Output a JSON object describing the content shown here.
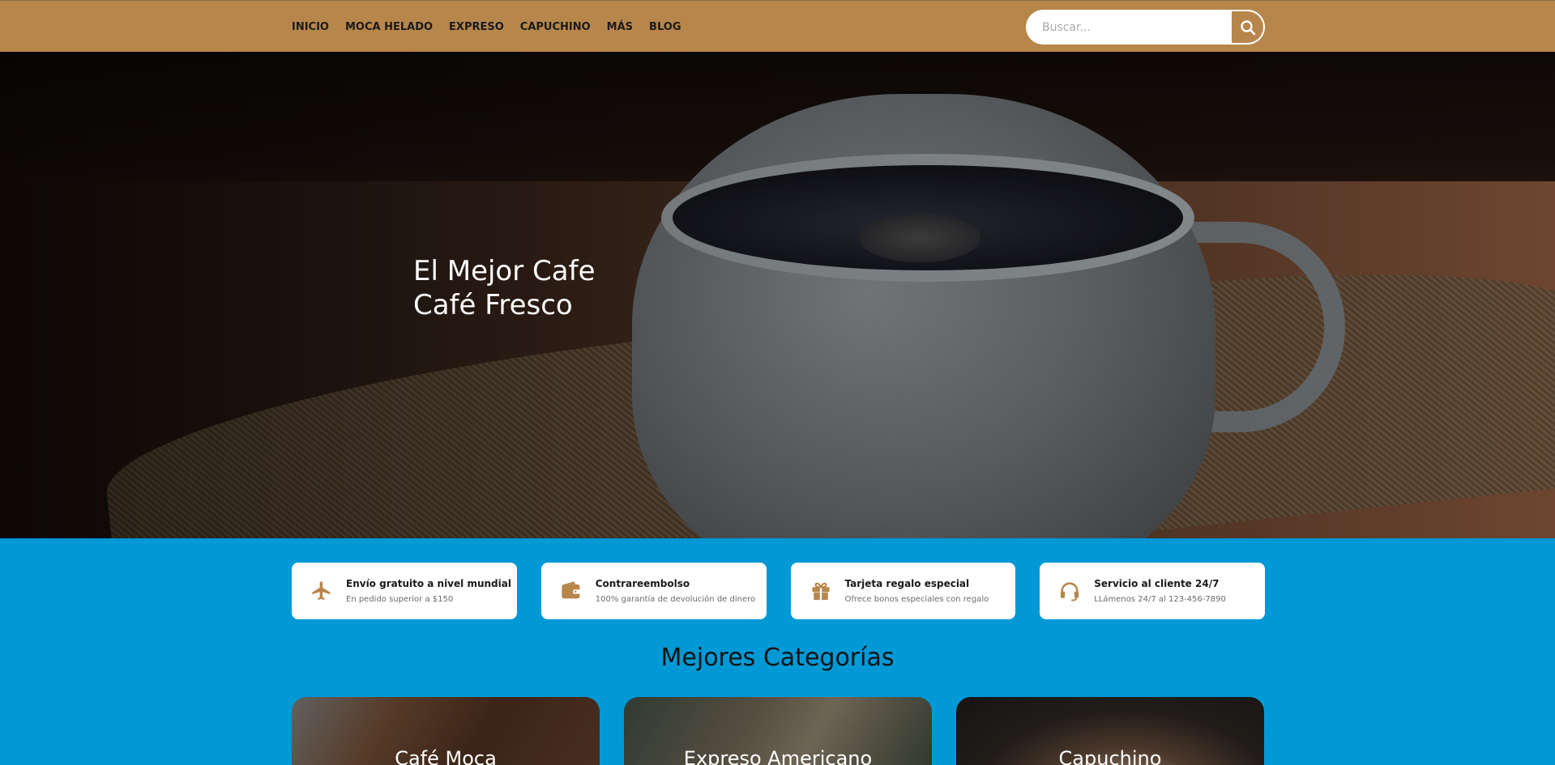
{
  "header": {
    "nav": [
      "INICIO",
      "MOCA HELADO",
      "EXPRESO",
      "CAPUCHINO",
      "MÁS",
      "BLOG"
    ],
    "search_placeholder": "Buscar..."
  },
  "hero": {
    "line1": "El Mejor Cafe",
    "line2": "Café Fresco"
  },
  "features": [
    {
      "icon": "plane-icon",
      "title": "Envío gratuito a nivel mundial",
      "sub": "En pedido superior a $150"
    },
    {
      "icon": "wallet-icon",
      "title": "Contrareembolso",
      "sub": "100% garantía de devolución de dinero"
    },
    {
      "icon": "gift-icon",
      "title": "Tarjeta regalo especial",
      "sub": "Ofrece bonos especiales con regalo"
    },
    {
      "icon": "headset-icon",
      "title": "Servicio al cliente 24/7",
      "sub": "LLámenos 24/7 al 123-456-7890"
    }
  ],
  "categories": {
    "heading": "Mejores Categorías",
    "items": [
      "Café Moca",
      "Expreso Americano",
      "Capuchino"
    ]
  },
  "colors": {
    "header_bg": "#b7864b",
    "accent": "#b7864b",
    "section_bg": "#0099d6"
  }
}
